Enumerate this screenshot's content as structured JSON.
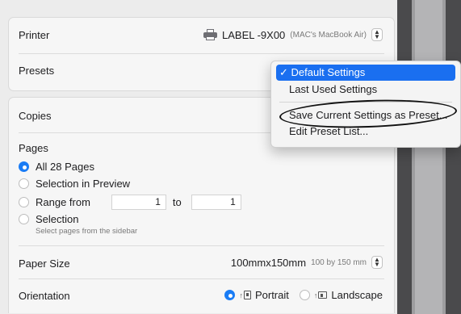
{
  "printer": {
    "label": "Printer",
    "name": "LABEL -9X00",
    "host": "(MAC's MacBook Air)"
  },
  "presets": {
    "label": "Presets",
    "menu": [
      {
        "label": "Default Settings",
        "checked": true
      },
      {
        "label": "Last Used Settings",
        "checked": false
      },
      {
        "label": "Save Current Settings as Preset...",
        "checked": false
      },
      {
        "label": "Edit Preset List...",
        "checked": false
      }
    ],
    "check_mark": "✓"
  },
  "copies": {
    "label": "Copies"
  },
  "pages": {
    "label": "Pages",
    "all": "All 28 Pages",
    "selection_preview": "Selection in Preview",
    "range_from": "Range from",
    "range_start": "1",
    "range_to": "to",
    "range_end": "1",
    "selection": "Selection",
    "selection_hint": "Select pages from the sidebar",
    "selected_option": "all"
  },
  "paper_size": {
    "label": "Paper Size",
    "value": "100mmx150mm",
    "detail": "100 by 150 mm"
  },
  "orientation": {
    "label": "Orientation",
    "portrait": "Portrait",
    "landscape": "Landscape",
    "selected": "portrait"
  },
  "colors": {
    "accent": "#1a7cf5",
    "menu_highlight": "#1a6ff0"
  }
}
